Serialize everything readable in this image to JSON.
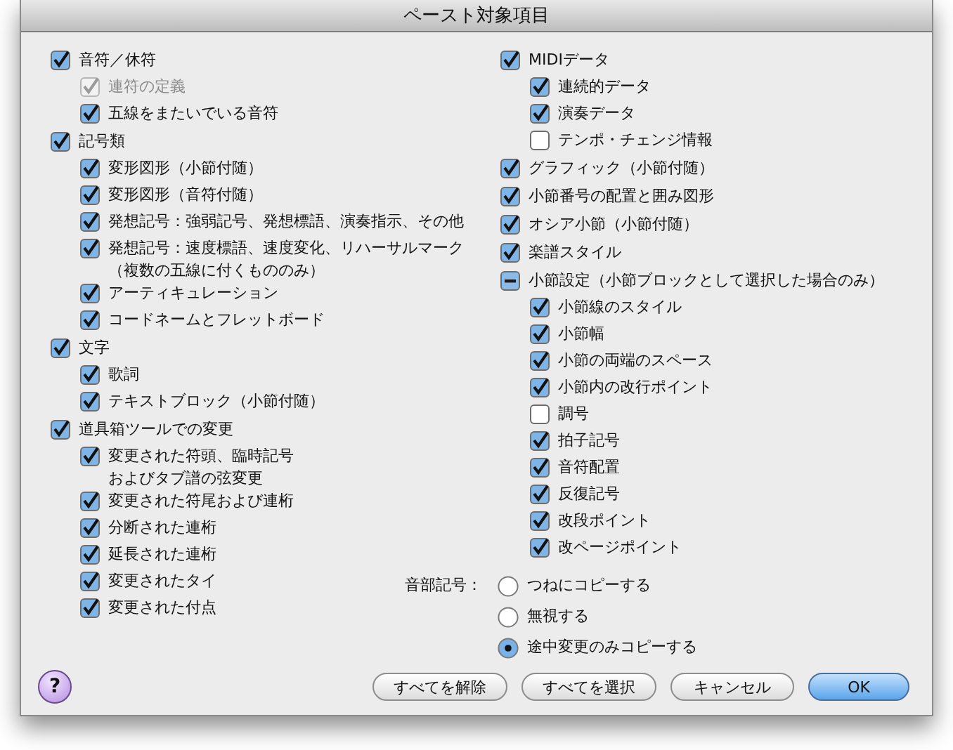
{
  "window": {
    "title": "ペースト対象項目"
  },
  "left": [
    {
      "label": "音符／休符",
      "checked": true,
      "mixed": false,
      "disabled": false,
      "children": [
        {
          "label": "連符の定義",
          "checked": true,
          "mixed": false,
          "disabled": true
        },
        {
          "label": "五線をまたいでいる音符",
          "checked": true,
          "mixed": false,
          "disabled": false
        }
      ]
    },
    {
      "label": "記号類",
      "checked": true,
      "mixed": false,
      "disabled": false,
      "children": [
        {
          "label": "変形図形（小節付随）",
          "checked": true,
          "mixed": false,
          "disabled": false
        },
        {
          "label": "変形図形（音符付随）",
          "checked": true,
          "mixed": false,
          "disabled": false
        },
        {
          "label": "発想記号：強弱記号、発想標語、演奏指示、その他",
          "checked": true,
          "mixed": false,
          "disabled": false
        },
        {
          "lines": [
            "発想記号：速度標語、速度変化、リハーサルマーク",
            "（複数の五線に付くもののみ）"
          ],
          "checked": true,
          "mixed": false,
          "disabled": false
        },
        {
          "label": "アーティキュレーション",
          "checked": true,
          "mixed": false,
          "disabled": false
        },
        {
          "label": "コードネームとフレットボード",
          "checked": true,
          "mixed": false,
          "disabled": false
        }
      ]
    },
    {
      "label": "文字",
      "checked": true,
      "mixed": false,
      "disabled": false,
      "children": [
        {
          "label": "歌詞",
          "checked": true,
          "mixed": false,
          "disabled": false
        },
        {
          "label": "テキストブロック（小節付随）",
          "checked": true,
          "mixed": false,
          "disabled": false
        }
      ]
    },
    {
      "label": "道具箱ツールでの変更",
      "checked": true,
      "mixed": false,
      "disabled": false,
      "children": [
        {
          "lines": [
            "変更された符頭、臨時記号",
            "およびタブ譜の弦変更"
          ],
          "checked": true,
          "mixed": false,
          "disabled": false
        },
        {
          "label": "変更された符尾および連桁",
          "checked": true,
          "mixed": false,
          "disabled": false
        },
        {
          "label": "分断された連桁",
          "checked": true,
          "mixed": false,
          "disabled": false
        },
        {
          "label": "延長された連桁",
          "checked": true,
          "mixed": false,
          "disabled": false
        },
        {
          "label": "変更されたタイ",
          "checked": true,
          "mixed": false,
          "disabled": false
        },
        {
          "label": "変更された付点",
          "checked": true,
          "mixed": false,
          "disabled": false
        }
      ]
    }
  ],
  "right": [
    {
      "label": "MIDIデータ",
      "checked": true,
      "mixed": false,
      "disabled": false,
      "children": [
        {
          "label": "連続的データ",
          "checked": true,
          "mixed": false,
          "disabled": false
        },
        {
          "label": "演奏データ",
          "checked": true,
          "mixed": false,
          "disabled": false
        },
        {
          "label": "テンポ・チェンジ情報",
          "checked": false,
          "mixed": false,
          "disabled": false
        }
      ]
    },
    {
      "label": "グラフィック（小節付随）",
      "checked": true,
      "mixed": false,
      "disabled": false
    },
    {
      "label": "小節番号の配置と囲み図形",
      "checked": true,
      "mixed": false,
      "disabled": false
    },
    {
      "label": "オシア小節（小節付随）",
      "checked": true,
      "mixed": false,
      "disabled": false
    },
    {
      "label": "楽譜スタイル",
      "checked": true,
      "mixed": false,
      "disabled": false
    },
    {
      "label": "小節設定（小節ブロックとして選択した場合のみ）",
      "checked": false,
      "mixed": true,
      "disabled": false,
      "children": [
        {
          "label": "小節線のスタイル",
          "checked": true,
          "mixed": false,
          "disabled": false
        },
        {
          "label": "小節幅",
          "checked": true,
          "mixed": false,
          "disabled": false
        },
        {
          "label": "小節の両端のスペース",
          "checked": true,
          "mixed": false,
          "disabled": false
        },
        {
          "label": "小節内の改行ポイント",
          "checked": true,
          "mixed": false,
          "disabled": false
        },
        {
          "label": "調号",
          "checked": false,
          "mixed": false,
          "disabled": false
        },
        {
          "label": "拍子記号",
          "checked": true,
          "mixed": false,
          "disabled": false
        },
        {
          "label": "音符配置",
          "checked": true,
          "mixed": false,
          "disabled": false
        },
        {
          "label": "反復記号",
          "checked": true,
          "mixed": false,
          "disabled": false
        },
        {
          "label": "改段ポイント",
          "checked": true,
          "mixed": false,
          "disabled": false
        },
        {
          "label": "改ページポイント",
          "checked": true,
          "mixed": false,
          "disabled": false
        }
      ]
    }
  ],
  "clef": {
    "label": "音部記号：",
    "options": [
      {
        "label": "つねにコピーする",
        "selected": false
      },
      {
        "label": "無視する",
        "selected": false
      },
      {
        "label": "途中変更のみコピーする",
        "selected": true
      }
    ]
  },
  "help": {
    "label": "?"
  },
  "buttons": [
    {
      "label": "すべてを解除",
      "default": false
    },
    {
      "label": "すべてを選択",
      "default": false
    },
    {
      "label": "キャンセル",
      "default": false
    },
    {
      "label": "OK",
      "default": true
    }
  ]
}
